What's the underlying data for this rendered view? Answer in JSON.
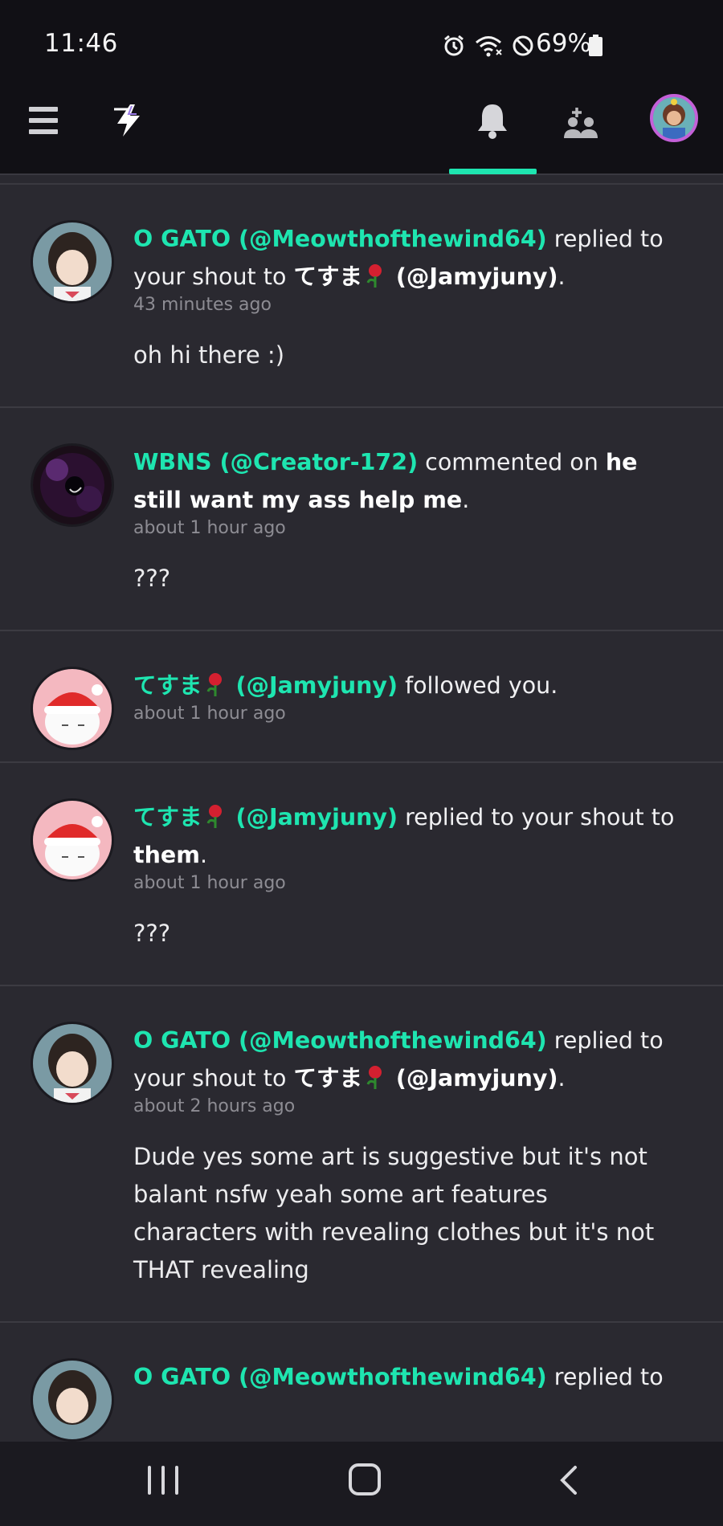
{
  "status_bar": {
    "time": "11:46",
    "battery": "69%",
    "icons": [
      "alarm-icon",
      "wifi-icon",
      "do-not-disturb-icon",
      "battery-icon"
    ]
  },
  "app_bar": {
    "icons": [
      "menu-icon",
      "app-logo-bolt-icon",
      "bell-icon",
      "friends-icon",
      "profile-avatar"
    ],
    "active_tab": "notifications",
    "accent_color": "#1ee5b0"
  },
  "notifications": [
    {
      "user": "O GATO (@Meowthofthewind64)",
      "action_pre": " replied to your shout to ",
      "target_name": "てすま",
      "target_handle": " (@Jamyjuny)",
      "action_post": ".",
      "time": "43 minutes ago",
      "body": "oh hi there :)"
    },
    {
      "user": "WBNS (@Creator-172)",
      "action_pre": " commented on ",
      "target": "he still want my ass help me",
      "action_post": ".",
      "time": "about 1 hour ago",
      "body": "???"
    },
    {
      "user_name": "てすま",
      "user_handle": " (@Jamyjuny)",
      "action": " followed you.",
      "time": "about 1 hour ago"
    },
    {
      "user_name": "てすま",
      "user_handle": " (@Jamyjuny)",
      "action_pre": " replied to your shout to ",
      "target": "them",
      "action_post": ".",
      "time": "about 1 hour ago",
      "body": "???"
    },
    {
      "user": "O GATO (@Meowthofthewind64)",
      "action_pre": " replied to your shout to ",
      "target_name": "てすま",
      "target_handle": " (@Jamyjuny)",
      "action_post": ".",
      "time": "about 2 hours ago",
      "body": "Dude yes some art is suggestive but it's not balant nsfw yeah some art features characters with revealing clothes but it's not THAT revealing"
    },
    {
      "user": "O GATO (@Meowthofthewind64)",
      "action_pre": " replied to"
    }
  ],
  "nav_bar": {
    "icons": [
      "recents-icon",
      "home-icon",
      "back-icon"
    ]
  }
}
